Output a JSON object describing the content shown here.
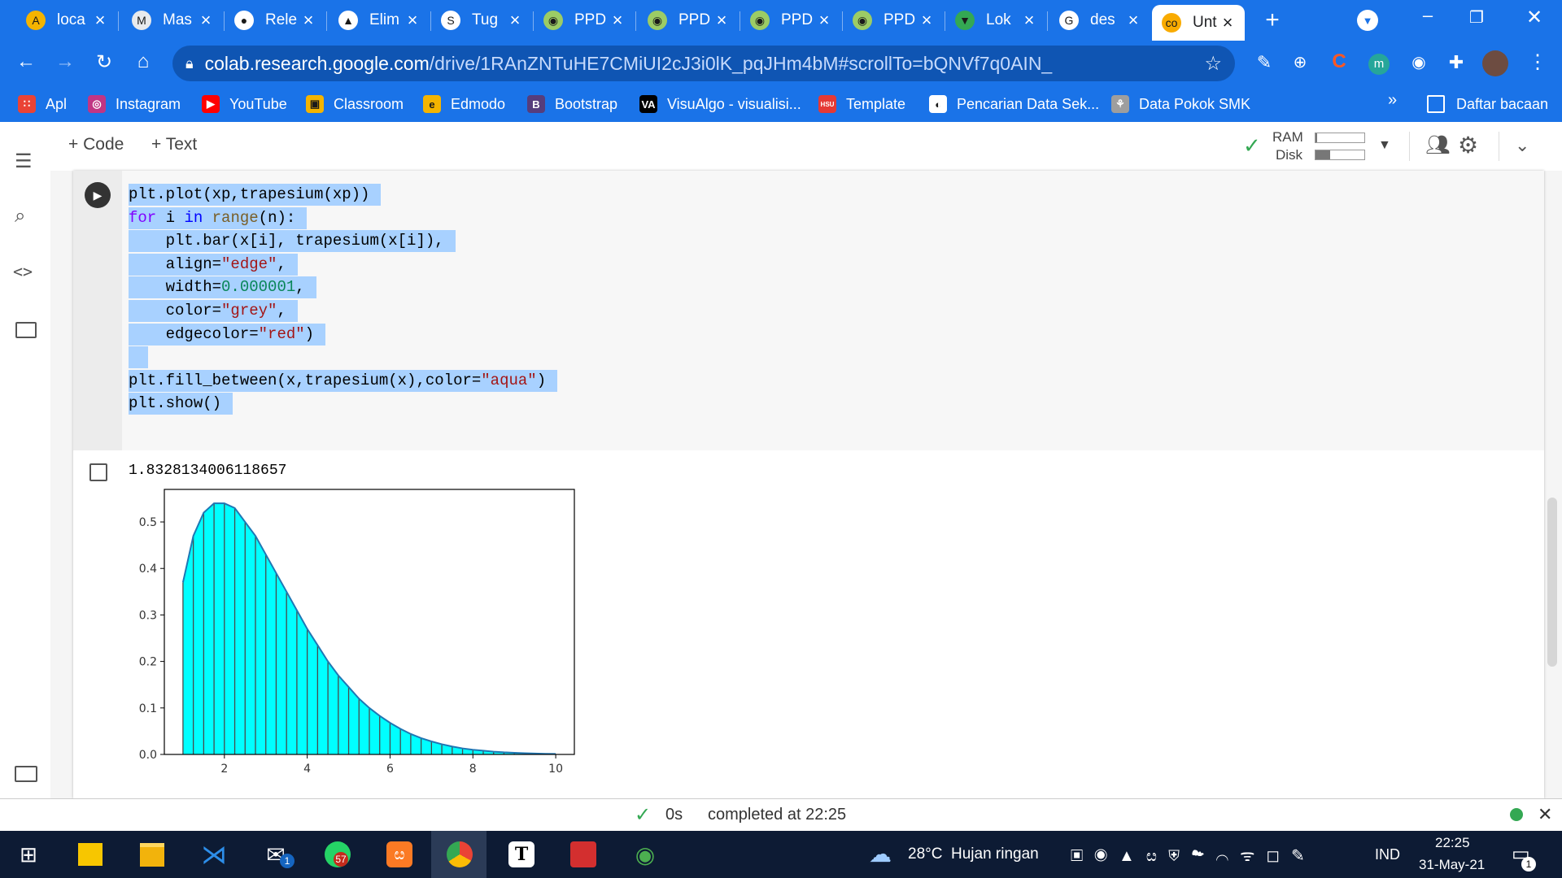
{
  "browser": {
    "tabs": [
      {
        "title": "loca",
        "icon": "A",
        "color": "#f4b400"
      },
      {
        "title": "Mas",
        "icon": "M",
        "color": "#e8eaed"
      },
      {
        "title": "Rele",
        "icon": "●",
        "color": "#ffffff"
      },
      {
        "title": "Elim",
        "icon": "▲",
        "color": "#ffffff"
      },
      {
        "title": "Tug",
        "icon": "S",
        "color": "#ffffff"
      },
      {
        "title": "PPD",
        "icon": "◉",
        "color": "#9ccc65"
      },
      {
        "title": "PPD",
        "icon": "◉",
        "color": "#9ccc65"
      },
      {
        "title": "PPD",
        "icon": "◉",
        "color": "#9ccc65"
      },
      {
        "title": "PPD",
        "icon": "◉",
        "color": "#9ccc65"
      },
      {
        "title": "Lok",
        "icon": "▼",
        "color": "#34a853"
      },
      {
        "title": "des",
        "icon": "G",
        "color": "#ffffff"
      },
      {
        "title": "Unt",
        "icon": "co",
        "color": "#f9ab00"
      }
    ],
    "url_host": "colab.research.google.com",
    "url_path": "/drive/1RAnZNTuHE7CMiUI2cJ3i0lK_pqJHm4bM#scrollTo=bQNVf7q0AIN_",
    "bookmarks": [
      {
        "label": "Apl",
        "icon": "∷",
        "color": "#ea4335"
      },
      {
        "label": "Instagram",
        "icon": "◎",
        "color": "#c13584"
      },
      {
        "label": "YouTube",
        "icon": "▶",
        "color": "#ff0000"
      },
      {
        "label": "Classroom",
        "icon": "▣",
        "color": "#f4b400"
      },
      {
        "label": "Edmodo",
        "icon": "e",
        "color": "#f4b400"
      },
      {
        "label": "Bootstrap",
        "icon": "B",
        "color": "#563d7c"
      },
      {
        "label": "VisuAlgo - visualisi...",
        "icon": "VA",
        "color": "#000000"
      },
      {
        "label": "Template",
        "icon": "HSU",
        "color": "#e53935"
      },
      {
        "label": "Pencarian Data Sek...",
        "icon": "◐",
        "color": "#ffffff"
      },
      {
        "label": "Data Pokok SMK",
        "icon": "⚘",
        "color": "#9e9e9e"
      }
    ],
    "more": "»",
    "reading_list": "Daftar bacaan"
  },
  "colab": {
    "add_code": "+ Code",
    "add_text": "+ Text",
    "ram_label": "RAM",
    "disk_label": "Disk",
    "ram_fraction": 0.03,
    "disk_fraction": 0.3
  },
  "code_lines": [
    [
      {
        "t": "plt.plot(xp,trapesium(xp))",
        "c": ""
      }
    ],
    [
      {
        "t": "for",
        "c": "kw"
      },
      {
        "t": " i ",
        "c": ""
      },
      {
        "t": "in",
        "c": "bl"
      },
      {
        "t": " ",
        "c": ""
      },
      {
        "t": "range",
        "c": "bt"
      },
      {
        "t": "(n):",
        "c": ""
      }
    ],
    [
      {
        "t": "    plt.bar(x[i], trapesium(x[i]),",
        "c": ""
      }
    ],
    [
      {
        "t": "    align=",
        "c": ""
      },
      {
        "t": "\"edge\"",
        "c": "st"
      },
      {
        "t": ",",
        "c": ""
      }
    ],
    [
      {
        "t": "    width=",
        "c": ""
      },
      {
        "t": "0.000001",
        "c": "nm"
      },
      {
        "t": ",",
        "c": ""
      }
    ],
    [
      {
        "t": "    color=",
        "c": ""
      },
      {
        "t": "\"grey\"",
        "c": "st"
      },
      {
        "t": ",",
        "c": ""
      }
    ],
    [
      {
        "t": "    edgecolor=",
        "c": ""
      },
      {
        "t": "\"red\"",
        "c": "st"
      },
      {
        "t": ")",
        "c": ""
      }
    ],
    [
      {
        "t": "",
        "c": ""
      }
    ],
    [
      {
        "t": "plt.fill_between(x,trapesium(x),color=",
        "c": ""
      },
      {
        "t": "\"aqua\"",
        "c": "st"
      },
      {
        "t": ")",
        "c": ""
      }
    ],
    [
      {
        "t": "plt.show()",
        "c": ""
      }
    ]
  ],
  "output": {
    "text": "1.8328134006118657"
  },
  "chart_data": {
    "type": "area",
    "x": [
      1.0,
      1.25,
      1.5,
      1.75,
      2.0,
      2.25,
      2.5,
      2.75,
      3.0,
      3.25,
      3.5,
      3.75,
      4.0,
      4.25,
      4.5,
      4.75,
      5.0,
      5.25,
      5.5,
      5.75,
      6.0,
      6.25,
      6.5,
      6.75,
      7.0,
      7.25,
      7.5,
      7.75,
      8.0,
      8.25,
      8.5,
      8.75,
      9.0,
      9.25,
      9.5,
      9.75,
      10.0
    ],
    "y": [
      0.37,
      0.47,
      0.52,
      0.54,
      0.54,
      0.53,
      0.5,
      0.47,
      0.43,
      0.39,
      0.35,
      0.31,
      0.27,
      0.235,
      0.2,
      0.17,
      0.145,
      0.12,
      0.1,
      0.083,
      0.068,
      0.055,
      0.044,
      0.035,
      0.028,
      0.022,
      0.017,
      0.013,
      0.01,
      0.008,
      0.006,
      0.0045,
      0.0035,
      0.0026,
      0.002,
      0.0014,
      0.001
    ],
    "xticks": [
      "2",
      "4",
      "6",
      "8",
      "10"
    ],
    "yticks": [
      "0.0",
      "0.1",
      "0.2",
      "0.3",
      "0.4",
      "0.5"
    ],
    "xlim": [
      0.55,
      10.45
    ],
    "ylim": [
      0,
      0.57
    ],
    "fill_color": "#00ffff",
    "bar_edge_color": "#4a4a4a",
    "line_color": "#1f77b4",
    "title": "",
    "xlabel": "",
    "ylabel": ""
  },
  "status": {
    "duration": "0s",
    "completed": "completed at 22:25"
  },
  "taskbar": {
    "weather": "28°C  Hujan ringan",
    "lang": "IND",
    "time": "22:25",
    "date": "31-May-21",
    "mail_badge": "1",
    "whatsapp_badge": "57",
    "notif_badge": "1"
  }
}
